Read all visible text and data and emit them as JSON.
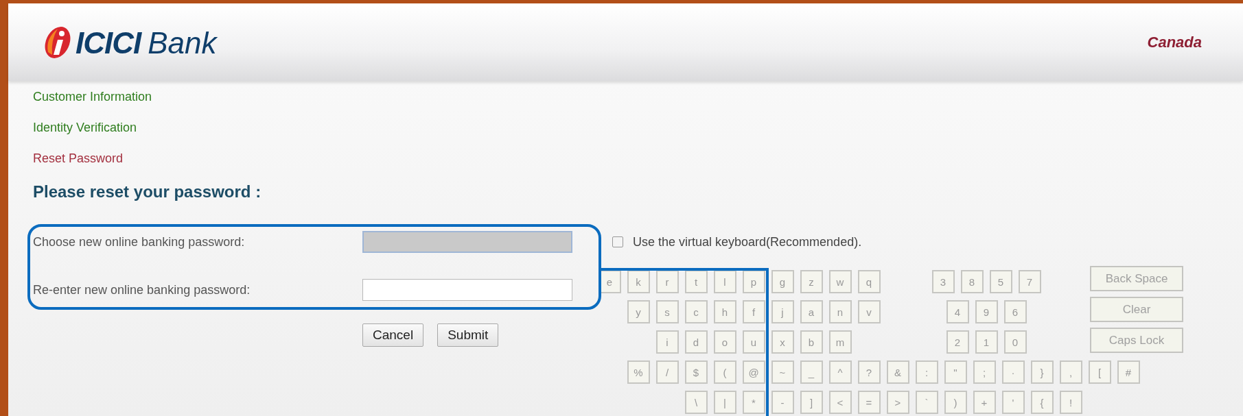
{
  "header": {
    "logo": {
      "mark_text": "ICICI",
      "name": "Bank"
    },
    "region": "Canada"
  },
  "steps": [
    {
      "label": "Customer Information",
      "current": false
    },
    {
      "label": "Identity Verification",
      "current": false
    },
    {
      "label": "Reset Password",
      "current": true
    }
  ],
  "heading": "Please reset your password :",
  "fields": [
    {
      "label": "Choose new online banking password:",
      "highlighted": true
    },
    {
      "label": "Re-enter new online banking password:",
      "highlighted": false
    }
  ],
  "buttons": [
    "Cancel",
    "Submit"
  ],
  "virtual_keyboard": {
    "label": "Use the virtual keyboard(Recommended).",
    "checked": false,
    "letter_rows": [
      [
        "e",
        "k",
        "r",
        "t",
        "l",
        "p",
        "g",
        "z",
        "w",
        "q"
      ],
      [
        "y",
        "s",
        "c",
        "h",
        "f",
        "j",
        "a",
        "n",
        "v"
      ],
      [
        "i",
        "d",
        "o",
        "u",
        "x",
        "b",
        "m"
      ]
    ],
    "number_rows": [
      [
        "3",
        "8",
        "5",
        "7"
      ],
      [
        "4",
        "9",
        "6"
      ],
      [
        "2",
        "1",
        "0"
      ]
    ],
    "function_keys": [
      "Back Space",
      "Clear",
      "Caps Lock"
    ],
    "symbol_rows": [
      [
        "%",
        "/",
        "$",
        "(",
        "@",
        "~",
        "_",
        "^",
        "?",
        "&",
        ":",
        "\"",
        ";",
        "·",
        "}",
        ",",
        "[",
        "#"
      ],
      [
        "\\",
        "|",
        "*",
        "-",
        "]",
        "<",
        "=",
        ">",
        "`",
        ")",
        "+",
        "'",
        "{",
        "!"
      ]
    ]
  }
}
